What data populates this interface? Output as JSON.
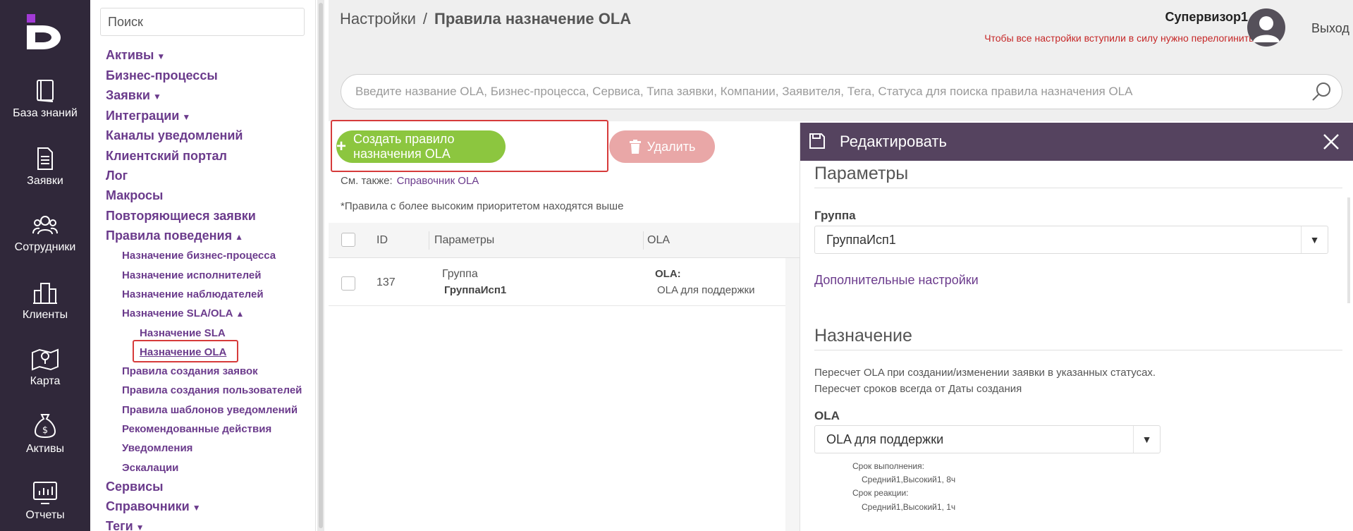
{
  "rail": {
    "items": [
      {
        "label": "База знаний",
        "icon": "book-icon"
      },
      {
        "label": "Заявки",
        "icon": "document-icon"
      },
      {
        "label": "Сотрудники",
        "icon": "users-icon"
      },
      {
        "label": "Клиенты",
        "icon": "building-icon"
      },
      {
        "label": "Карта",
        "icon": "map-icon"
      },
      {
        "label": "Активы",
        "icon": "money-bag-icon"
      },
      {
        "label": "Отчеты",
        "icon": "chart-monitor-icon"
      }
    ]
  },
  "nav": {
    "search_placeholder": "Поиск",
    "items": [
      {
        "label": "Активы",
        "caret": "▼"
      },
      {
        "label": "Бизнес-процессы",
        "caret": ""
      },
      {
        "label": "Заявки",
        "caret": "▼"
      },
      {
        "label": "Интеграции",
        "caret": "▼"
      },
      {
        "label": "Каналы уведомлений",
        "caret": ""
      },
      {
        "label": "Клиентский портал",
        "caret": ""
      },
      {
        "label": "Лог",
        "caret": ""
      },
      {
        "label": "Макросы",
        "caret": ""
      },
      {
        "label": "Повторяющиеся заявки",
        "caret": ""
      },
      {
        "label": "Правила поведения",
        "caret": "▲"
      },
      {
        "label": "Назначение бизнес-процесса",
        "caret": ""
      },
      {
        "label": "Назначение исполнителей",
        "caret": ""
      },
      {
        "label": "Назначение наблюдателей",
        "caret": ""
      },
      {
        "label": "Назначение SLA/OLA",
        "caret": "▲"
      },
      {
        "label": "Назначение SLA",
        "caret": ""
      },
      {
        "label": "Назначение OLA",
        "caret": ""
      },
      {
        "label": "Правила создания заявок",
        "caret": ""
      },
      {
        "label": "Правила создания пользователей",
        "caret": ""
      },
      {
        "label": "Правила шаблонов уведомлений",
        "caret": ""
      },
      {
        "label": "Рекомендованные действия",
        "caret": ""
      },
      {
        "label": "Уведомления",
        "caret": ""
      },
      {
        "label": "Эскалации",
        "caret": ""
      },
      {
        "label": "Сервисы",
        "caret": ""
      },
      {
        "label": "Справочники",
        "caret": "▼"
      },
      {
        "label": "Теги",
        "caret": "▼"
      }
    ]
  },
  "header": {
    "breadcrumb_root": "Настройки",
    "breadcrumb_sep": "/",
    "breadcrumb_current": "Правила назначение OLA",
    "user_name": "Супервизор1 А.",
    "relogin_notice": "Чтобы все настройки вступили в силу нужно перелогиниться",
    "logout_label": "Выход",
    "search_placeholder": "Введите название OLA, Бизнес-процесса, Сервиса, Типа заявки, Компании, Заявителя, Тега, Статуса для поиска правила назначения OLA"
  },
  "toolbar": {
    "create_label": "Создать правило назначения OLA",
    "delete_label": "Удалить",
    "see_also_prefix": "См. также:",
    "see_also_link": "Справочник OLA",
    "priority_note": "*Правила с более высоким приоритетом находятся выше"
  },
  "table": {
    "columns": [
      "ID",
      "Параметры",
      "OLA"
    ],
    "rows": [
      {
        "id": "137",
        "param_label": "Группа",
        "param_value": "ГруппаИсп1",
        "ola_label": "OLA:",
        "ola_value": "OLA для поддержки"
      }
    ]
  },
  "panel": {
    "title": "Редактировать",
    "params_title": "Параметры",
    "group_label": "Группа",
    "group_value": "ГруппаИсп1",
    "more_settings": "Дополнительные настройки",
    "assign_title": "Назначение",
    "recalc_line1": "Пересчет OLA при создании/изменении заявки в указанных статусах.",
    "recalc_line2": "Пересчет сроков всегда от Даты создания",
    "ola_label": "OLA",
    "ola_value": "OLA для поддержки",
    "deadline_label": "Срок выполнения:",
    "deadline_value": "Средний1,Высокий1, 8ч",
    "reaction_label": "Срок реакции:",
    "reaction_value": "Средний1,Высокий1, 1ч"
  },
  "colors": {
    "rail_bg": "#30283a",
    "accent_purple": "#6b3b8c",
    "create_green": "#8cc63f",
    "delete_pink": "#e9a7a7",
    "panel_header": "#55435f",
    "alert_red": "#c62828",
    "highlight_red": "#d63b3b"
  }
}
